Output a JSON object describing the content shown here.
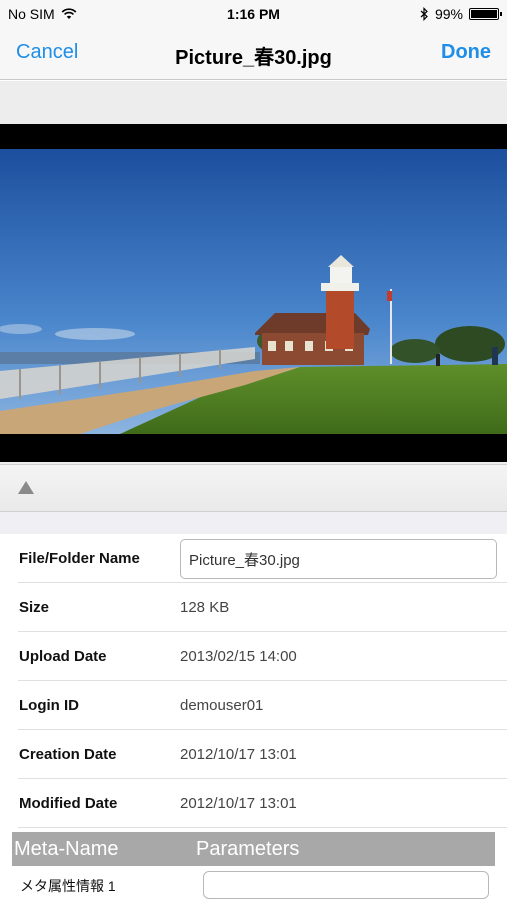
{
  "status_bar": {
    "carrier": "No SIM",
    "time": "1:16 PM",
    "battery_percent": "99%",
    "battery_level": 0.99
  },
  "nav": {
    "cancel_label": "Cancel",
    "title": "Picture_春30.jpg",
    "done_label": "Done"
  },
  "preview": {
    "image_subject": "lighthouse-photo"
  },
  "toolbar": {
    "toggle_icon": "triangle-up-icon"
  },
  "details": {
    "file_name_label": "File/Folder Name",
    "file_name_value": "Picture_春30.jpg",
    "rows": [
      {
        "label": "Size",
        "value": "128 KB"
      },
      {
        "label": "Upload Date",
        "value": "2013/02/15 14:00"
      },
      {
        "label": "Login ID",
        "value": "demouser01"
      },
      {
        "label": "Creation Date",
        "value": "2012/10/17 13:01"
      },
      {
        "label": "Modified Date",
        "value": "2012/10/17 13:01"
      }
    ]
  },
  "meta": {
    "header_name": "Meta-Name",
    "header_params": "Parameters",
    "items": [
      {
        "label": "メタ属性情報 1",
        "value": ""
      }
    ]
  },
  "colors": {
    "accent": "#1e8ee8",
    "meta_header_bg": "#a8a8a8"
  }
}
